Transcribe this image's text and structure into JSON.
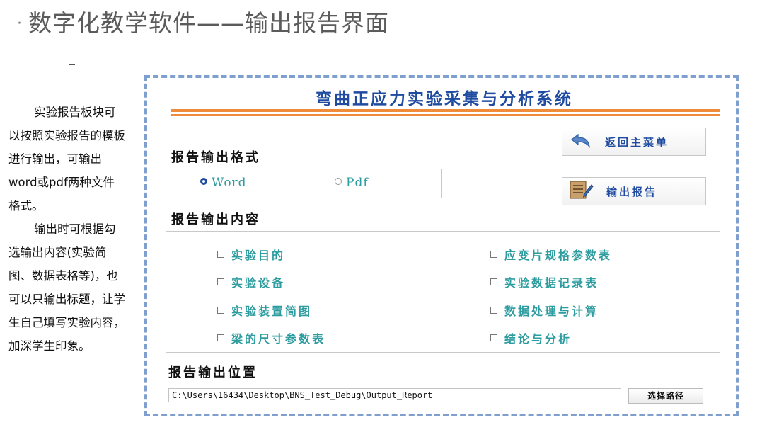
{
  "slide": {
    "title_bullet": "·",
    "title": "数字化教学软件——输出报告界面",
    "side_text": [
      "实验报告板块可以按照实验报告的模板进行输出，可输出word或pdf两种文件格式。",
      "输出时可根据勾选输出内容(实验简图、数据表格等)，也可以只输出标题，让学生自己填写实验内容，加深学生印象。"
    ]
  },
  "app": {
    "title": "弯曲正应力实验采集与分析系统",
    "buttons": {
      "back_menu": "返回主菜单",
      "export_report": "输出报告",
      "choose_path": "选择路径"
    },
    "format_section": {
      "heading": "报告输出格式",
      "options": [
        {
          "label": "Word",
          "selected": true
        },
        {
          "label": "Pdf",
          "selected": false
        }
      ]
    },
    "content_section": {
      "heading": "报告输出内容",
      "items": [
        {
          "label": "实验目的",
          "checked": false
        },
        {
          "label": "应变片规格参数表",
          "checked": false
        },
        {
          "label": "实验设备",
          "checked": false
        },
        {
          "label": "实验数据记录表",
          "checked": false
        },
        {
          "label": "实验装置简图",
          "checked": false
        },
        {
          "label": "数据处理与计算",
          "checked": false
        },
        {
          "label": "梁的尺寸参数表",
          "checked": false
        },
        {
          "label": "结论与分析",
          "checked": false
        }
      ]
    },
    "location_section": {
      "heading": "报告输出位置",
      "path_value": "C:\\Users\\16434\\Desktop\\BNS_Test_Debug\\Output_Report"
    }
  },
  "colors": {
    "frame_dash": "#7f9fcf",
    "title_blue": "#1f4ba0",
    "option_teal": "#2d9c9f",
    "rule_orange": "#ee8c3a"
  }
}
